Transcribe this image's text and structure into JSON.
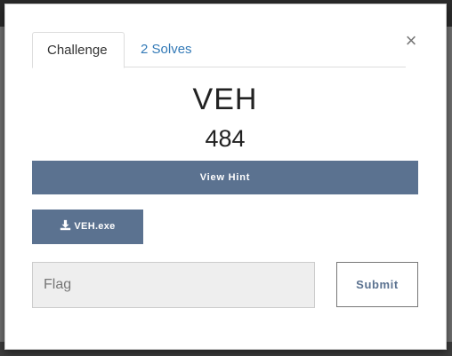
{
  "tabs": [
    {
      "label": "Challenge",
      "active": true
    },
    {
      "label": "2 Solves",
      "active": false
    }
  ],
  "close": {
    "glyph": "×",
    "icon": "close-icon"
  },
  "challenge": {
    "name": "VEH",
    "value": "484"
  },
  "hint": {
    "label": "View Hint"
  },
  "file": {
    "label": "VEH.exe",
    "icon": "download-icon"
  },
  "flag": {
    "placeholder": "Flag",
    "value": ""
  },
  "submit": {
    "label": "Submit"
  },
  "colors": {
    "accent": "#5b7290",
    "link": "#337ab7"
  }
}
